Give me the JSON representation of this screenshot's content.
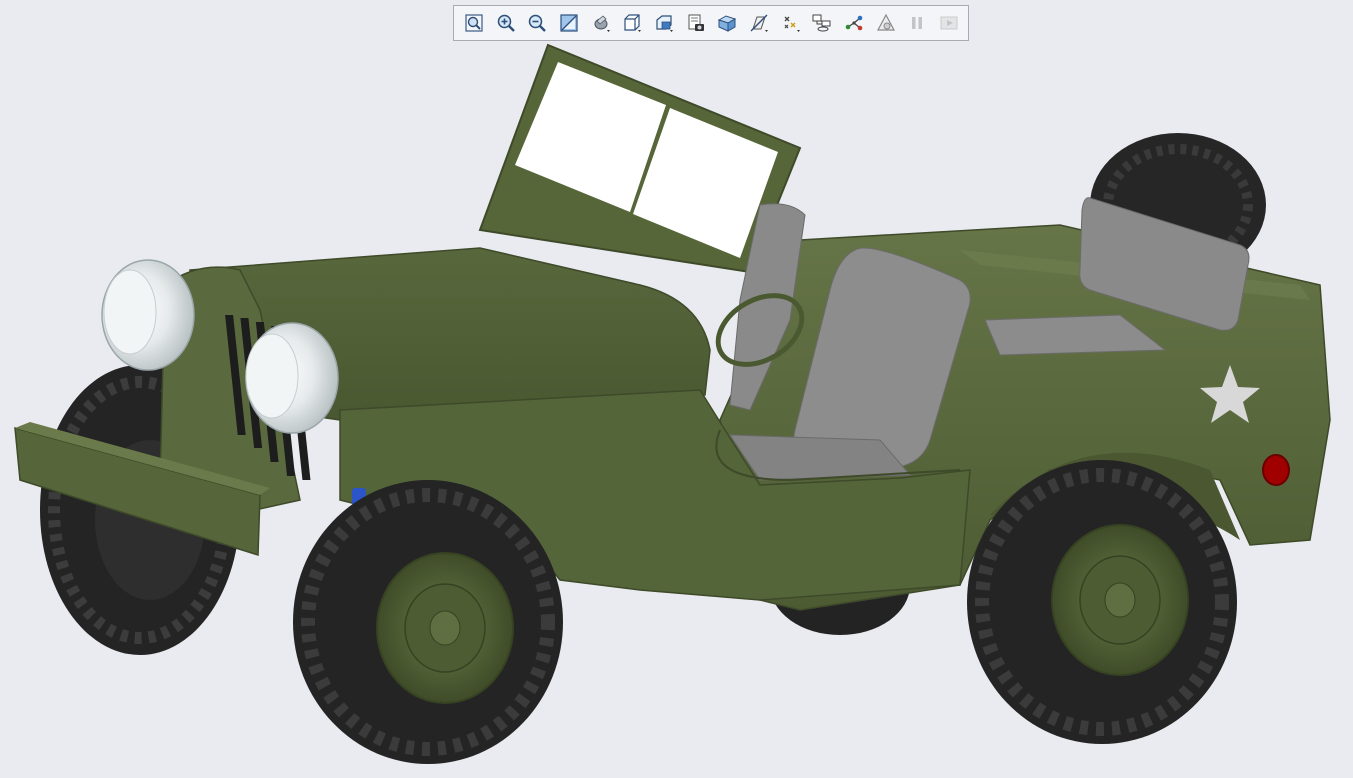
{
  "viewport": {
    "background": "#eaebf0"
  },
  "toolbar": {
    "items": [
      {
        "icon": "refit-icon",
        "enabled": true
      },
      {
        "icon": "zoom-in-icon",
        "enabled": true
      },
      {
        "icon": "zoom-out-icon",
        "enabled": true
      },
      {
        "icon": "repaint-icon",
        "enabled": true
      },
      {
        "icon": "display-style-icon",
        "enabled": true
      },
      {
        "icon": "saved-views-icon",
        "enabled": true
      },
      {
        "icon": "view-manager-icon",
        "enabled": true
      },
      {
        "icon": "snapshot-icon",
        "enabled": true
      },
      {
        "icon": "section-view-icon",
        "enabled": true
      },
      {
        "icon": "datum-display-icon",
        "enabled": true
      },
      {
        "icon": "annotation-display-icon",
        "enabled": true
      },
      {
        "icon": "spin-center-icon",
        "enabled": true
      },
      {
        "icon": "view-normal-icon",
        "enabled": true
      },
      {
        "icon": "appearance-icon",
        "enabled": true
      },
      {
        "icon": "pause-icon",
        "enabled": false
      },
      {
        "icon": "next-step-icon",
        "enabled": false
      }
    ]
  },
  "model": {
    "body_color": "#5a6a3e",
    "tire_color": "#262626",
    "seat_color": "#8a8a8a",
    "headlight_color": "#e8eced",
    "star_color": "#d8d8d8",
    "taillight_color": "#a00000",
    "spring_color": "#2b55c8"
  }
}
